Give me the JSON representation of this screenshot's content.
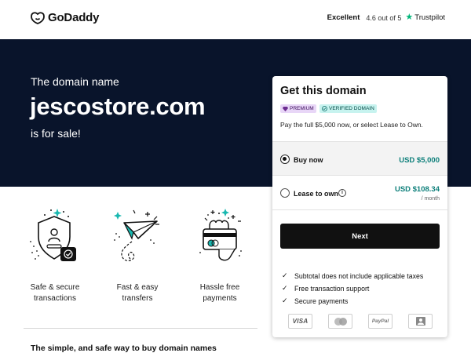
{
  "header": {
    "logo_text": "GoDaddy",
    "trust_rating": "Excellent",
    "trust_score": "4.6 out of 5",
    "trust_brand": "Trustpilot"
  },
  "hero": {
    "pre_text": "The domain name",
    "domain": "jescostore.com",
    "post_text": "is for sale!"
  },
  "features": [
    {
      "icon": "shield-lock-icon",
      "line1": "Safe & secure",
      "line2": "transactions"
    },
    {
      "icon": "paper-plane-icon",
      "line1": "Fast & easy",
      "line2": "transfers"
    },
    {
      "icon": "hand-card-icon",
      "line1": "Hassle free",
      "line2": "payments"
    }
  ],
  "bottom_text": "The simple, and safe way to buy domain names",
  "card": {
    "title": "Get this domain",
    "badge_premium": "PREMIUM",
    "badge_verified": "VERIFIED DOMAIN",
    "description": "Pay the full $5,000 now, or select Lease to Own.",
    "options": {
      "buy": {
        "label": "Buy now",
        "price": "USD $5,000",
        "selected": true
      },
      "lease": {
        "label": "Lease to own",
        "price": "USD $108.34",
        "period": "/ month",
        "selected": false
      }
    },
    "next_label": "Next",
    "checks": [
      "Subtotal does not include applicable taxes",
      "Free transaction support",
      "Secure payments"
    ],
    "payment_methods": {
      "visa": "VISA",
      "mastercard": "mastercard-icon",
      "paypal": "PayPal",
      "bank": "bank-transfer-icon"
    }
  },
  "colors": {
    "hero_bg": "#09142b",
    "price_teal": "#0d7f7a",
    "trustpilot_green": "#00b67a",
    "button_black": "#111111"
  }
}
